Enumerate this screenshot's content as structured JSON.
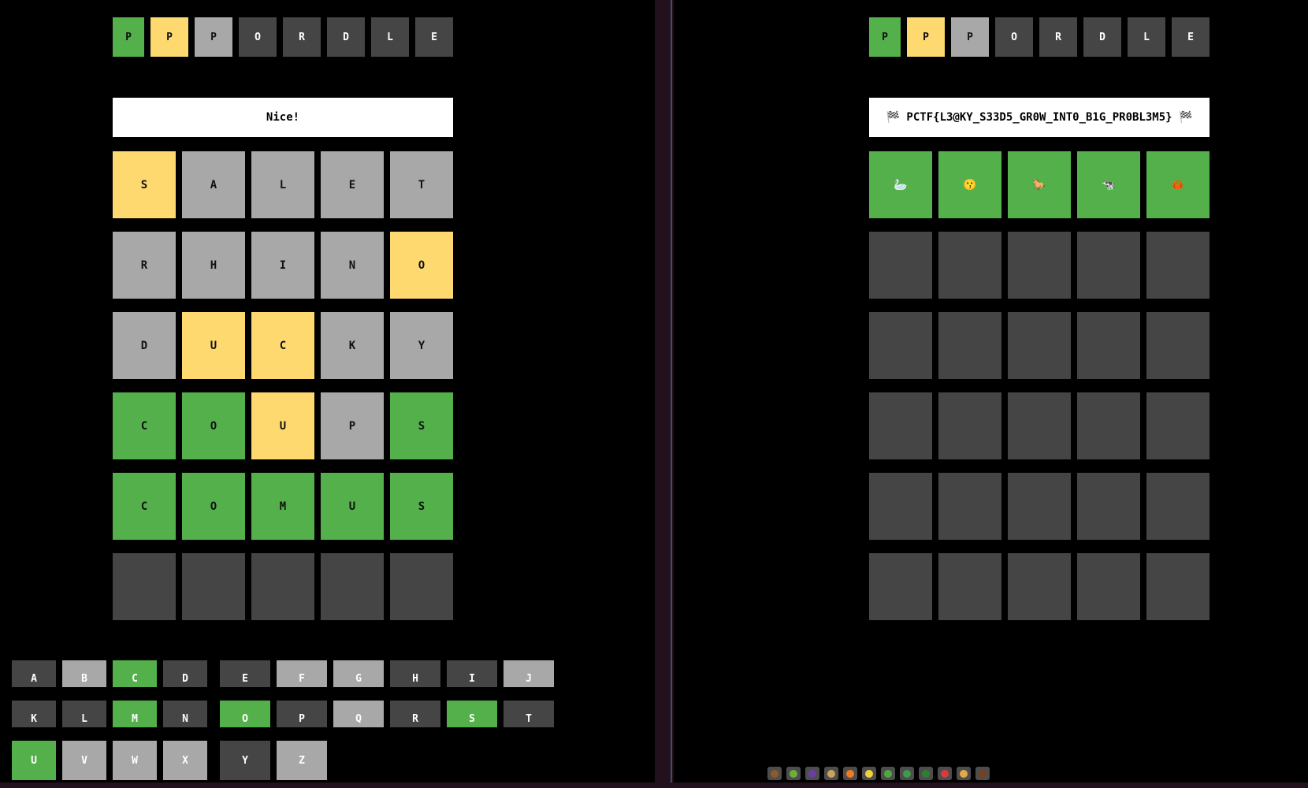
{
  "left_pane": {
    "title_tiles": [
      {
        "letter": "P",
        "state": "g"
      },
      {
        "letter": "P",
        "state": "y"
      },
      {
        "letter": "P",
        "state": "l"
      },
      {
        "letter": "O",
        "state": "d"
      },
      {
        "letter": "R",
        "state": "d"
      },
      {
        "letter": "D",
        "state": "d"
      },
      {
        "letter": "L",
        "state": "d"
      },
      {
        "letter": "E",
        "state": "d"
      }
    ],
    "message": "Nice!",
    "board": [
      [
        {
          "letter": "S",
          "state": "y"
        },
        {
          "letter": "A",
          "state": "l"
        },
        {
          "letter": "L",
          "state": "l"
        },
        {
          "letter": "E",
          "state": "l"
        },
        {
          "letter": "T",
          "state": "l"
        }
      ],
      [
        {
          "letter": "R",
          "state": "l"
        },
        {
          "letter": "H",
          "state": "l"
        },
        {
          "letter": "I",
          "state": "l"
        },
        {
          "letter": "N",
          "state": "l"
        },
        {
          "letter": "O",
          "state": "y"
        }
      ],
      [
        {
          "letter": "D",
          "state": "l"
        },
        {
          "letter": "U",
          "state": "y"
        },
        {
          "letter": "C",
          "state": "y"
        },
        {
          "letter": "K",
          "state": "l"
        },
        {
          "letter": "Y",
          "state": "l"
        }
      ],
      [
        {
          "letter": "C",
          "state": "g"
        },
        {
          "letter": "O",
          "state": "g"
        },
        {
          "letter": "U",
          "state": "y"
        },
        {
          "letter": "P",
          "state": "l"
        },
        {
          "letter": "S",
          "state": "g"
        }
      ],
      [
        {
          "letter": "C",
          "state": "g"
        },
        {
          "letter": "O",
          "state": "g"
        },
        {
          "letter": "M",
          "state": "g"
        },
        {
          "letter": "U",
          "state": "g"
        },
        {
          "letter": "S",
          "state": "g"
        }
      ],
      [
        {
          "letter": "",
          "state": "d"
        },
        {
          "letter": "",
          "state": "d"
        },
        {
          "letter": "",
          "state": "d"
        },
        {
          "letter": "",
          "state": "d"
        },
        {
          "letter": "",
          "state": "d"
        }
      ]
    ],
    "keyboard": [
      [
        {
          "key": "A",
          "state": "d"
        },
        {
          "key": "B",
          "state": "l"
        },
        {
          "key": "C",
          "state": "g"
        },
        {
          "key": "D",
          "state": "d"
        },
        {
          "key": "E",
          "state": "d"
        },
        {
          "key": "F",
          "state": "l"
        },
        {
          "key": "G",
          "state": "l"
        },
        {
          "key": "H",
          "state": "d"
        },
        {
          "key": "I",
          "state": "d"
        },
        {
          "key": "J",
          "state": "l"
        }
      ],
      [
        {
          "key": "K",
          "state": "d"
        },
        {
          "key": "L",
          "state": "d"
        },
        {
          "key": "M",
          "state": "g"
        },
        {
          "key": "N",
          "state": "d"
        },
        {
          "key": "O",
          "state": "g"
        },
        {
          "key": "P",
          "state": "d"
        },
        {
          "key": "Q",
          "state": "l"
        },
        {
          "key": "R",
          "state": "d"
        },
        {
          "key": "S",
          "state": "g"
        },
        {
          "key": "T",
          "state": "d"
        }
      ],
      [
        {
          "key": "U",
          "state": "g"
        },
        {
          "key": "V",
          "state": "l"
        },
        {
          "key": "W",
          "state": "l"
        },
        {
          "key": "X",
          "state": "l"
        },
        {
          "key": "Y",
          "state": "d"
        },
        {
          "key": "Z",
          "state": "l"
        }
      ]
    ]
  },
  "right_pane": {
    "title_tiles": [
      {
        "letter": "P",
        "state": "g"
      },
      {
        "letter": "P",
        "state": "y"
      },
      {
        "letter": "P",
        "state": "l"
      },
      {
        "letter": "O",
        "state": "d"
      },
      {
        "letter": "R",
        "state": "d"
      },
      {
        "letter": "D",
        "state": "d"
      },
      {
        "letter": "L",
        "state": "d"
      },
      {
        "letter": "E",
        "state": "d"
      }
    ],
    "message": "🏁 PCTF{L3@KY_S33D5_GR0W_INT0_B1G_PR0BL3M5} 🏁",
    "board": [
      [
        {
          "letter": "🦢",
          "state": "g"
        },
        {
          "letter": "😗",
          "state": "g"
        },
        {
          "letter": "🐎",
          "state": "g"
        },
        {
          "letter": "🐄",
          "state": "g"
        },
        {
          "letter": "🦀",
          "state": "g"
        }
      ],
      [
        {
          "letter": "",
          "state": "d"
        },
        {
          "letter": "",
          "state": "d"
        },
        {
          "letter": "",
          "state": "d"
        },
        {
          "letter": "",
          "state": "d"
        },
        {
          "letter": "",
          "state": "d"
        }
      ],
      [
        {
          "letter": "",
          "state": "d"
        },
        {
          "letter": "",
          "state": "d"
        },
        {
          "letter": "",
          "state": "d"
        },
        {
          "letter": "",
          "state": "d"
        },
        {
          "letter": "",
          "state": "d"
        }
      ],
      [
        {
          "letter": "",
          "state": "d"
        },
        {
          "letter": "",
          "state": "d"
        },
        {
          "letter": "",
          "state": "d"
        },
        {
          "letter": "",
          "state": "d"
        },
        {
          "letter": "",
          "state": "d"
        }
      ],
      [
        {
          "letter": "",
          "state": "d"
        },
        {
          "letter": "",
          "state": "d"
        },
        {
          "letter": "",
          "state": "d"
        },
        {
          "letter": "",
          "state": "d"
        },
        {
          "letter": "",
          "state": "d"
        }
      ],
      [
        {
          "letter": "",
          "state": "d"
        },
        {
          "letter": "",
          "state": "d"
        },
        {
          "letter": "",
          "state": "d"
        },
        {
          "letter": "",
          "state": "d"
        },
        {
          "letter": "",
          "state": "d"
        }
      ]
    ],
    "tray_icons": [
      {
        "name": "coconut-icon",
        "color": "#8a5a2b"
      },
      {
        "name": "avocado-icon",
        "color": "#6fae3a"
      },
      {
        "name": "eggplant-icon",
        "color": "#6b3fa0"
      },
      {
        "name": "potato-icon",
        "color": "#c9a45c"
      },
      {
        "name": "carrot-icon",
        "color": "#f07b21"
      },
      {
        "name": "corn-icon",
        "color": "#f2d23c"
      },
      {
        "name": "cucumber-icon",
        "color": "#4fa83d"
      },
      {
        "name": "leafy-green-icon",
        "color": "#3f9a4a"
      },
      {
        "name": "broccoli-icon",
        "color": "#2f7f32"
      },
      {
        "name": "mushroom-icon",
        "color": "#d93b3b"
      },
      {
        "name": "baguette-icon",
        "color": "#e3a84a"
      },
      {
        "name": "chestnut-icon",
        "color": "#7a3f1f"
      }
    ]
  }
}
